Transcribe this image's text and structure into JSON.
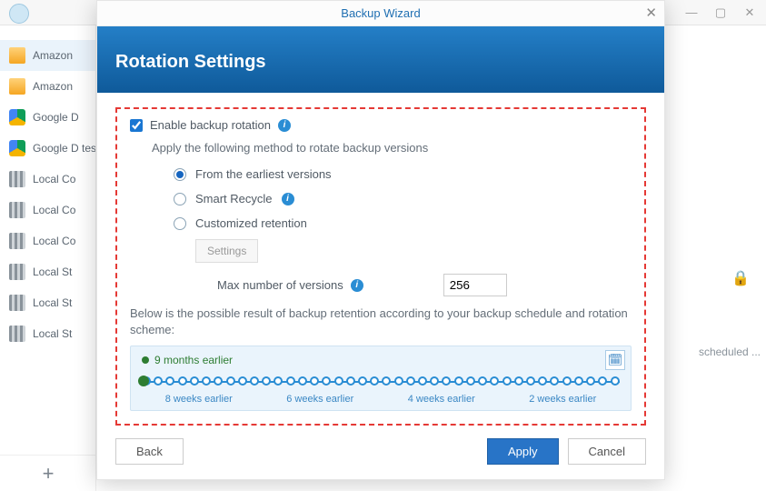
{
  "bg": {
    "sidebar": [
      {
        "icon": "amazon",
        "label": "Amazon"
      },
      {
        "icon": "amazon",
        "label": "Amazon"
      },
      {
        "icon": "gdrive",
        "label": "Google D"
      },
      {
        "icon": "gdrive",
        "label": "Google D test"
      },
      {
        "icon": "local",
        "label": "Local Co"
      },
      {
        "icon": "local",
        "label": "Local Co"
      },
      {
        "icon": "local",
        "label": "Local Co"
      },
      {
        "icon": "local",
        "label": "Local St"
      },
      {
        "icon": "local",
        "label": "Local St"
      },
      {
        "icon": "local",
        "label": "Local St"
      }
    ],
    "scheduled_text": "scheduled ..."
  },
  "modal": {
    "title": "Backup Wizard",
    "banner": "Rotation Settings",
    "enable_label": "Enable backup rotation",
    "method_label": "Apply the following method to rotate backup versions",
    "radios": {
      "earliest": "From the earliest versions",
      "smart": "Smart Recycle",
      "custom": "Customized retention"
    },
    "settings_btn": "Settings",
    "max_label": "Max number of versions",
    "max_value": "256",
    "note": "Below is the possible result of backup retention according to your backup schedule and rotation scheme:",
    "timeline": {
      "top_label": "9 months earlier",
      "labels": [
        "8 weeks earlier",
        "6 weeks earlier",
        "4 weeks earlier",
        "2 weeks earlier"
      ]
    },
    "buttons": {
      "back": "Back",
      "apply": "Apply",
      "cancel": "Cancel"
    }
  }
}
